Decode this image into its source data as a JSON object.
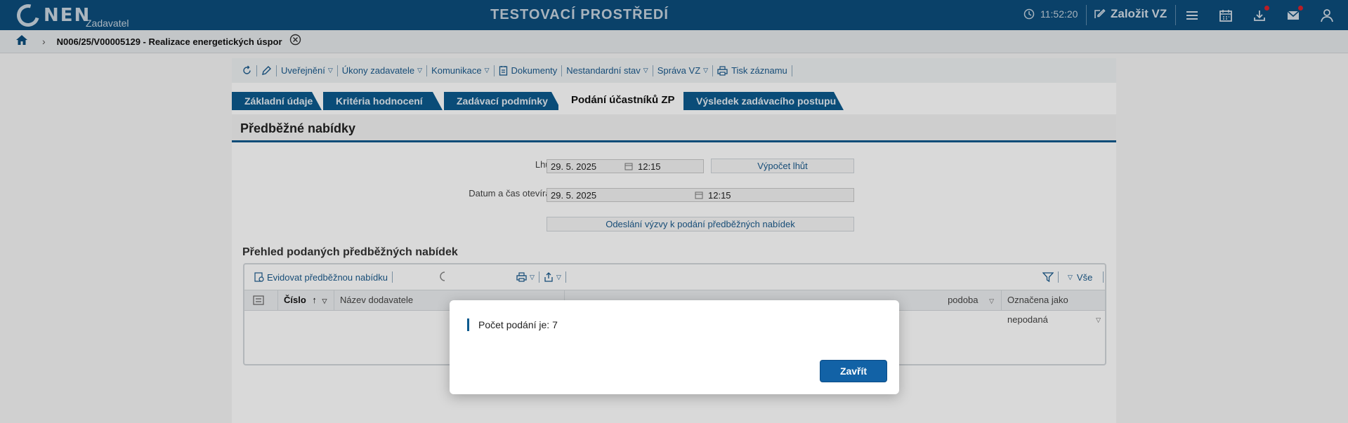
{
  "header": {
    "logo_text": "NEN",
    "logo_sub": "Zadavatel",
    "env_title": "TESTOVACÍ PROSTŘEDÍ",
    "time": "11:52:20",
    "create_vz_label": "Založit VZ"
  },
  "breadcrumb": {
    "title": "N006/25/V00005129 - Realizace energetických úspor"
  },
  "toolbar": {
    "items": [
      "Uveřejnění",
      "Úkony zadavatele",
      "Komunikace",
      "Dokumenty",
      "Nestandardní stav",
      "Správa VZ",
      "Tisk záznamu"
    ]
  },
  "tabs": [
    "Základní údaje",
    "Kritéria hodnocení",
    "Zadávací podmínky",
    "Podání účastníků ZP",
    "Výsledek zadávacího postupu"
  ],
  "section": {
    "title": "Předběžné nabídky",
    "deadline_label": "Lhůta:",
    "deadline_date": "29. 5. 2025",
    "deadline_time": "12:15",
    "calc_button": "Výpočet lhůt",
    "opening_label": "Datum a čas otevírání:",
    "opening_date": "29. 5. 2025",
    "opening_time": "12:15",
    "send_button": "Odeslání výzvy k podání předběžných nabídek"
  },
  "grid": {
    "title": "Přehled podaných předběžných nabídek",
    "add_button": "Evidovat předběžnou nabídku",
    "filter_all": "Vše",
    "columns": [
      "Číslo",
      "Název dodavatele",
      "podoba",
      "Označena jako nepodaná"
    ]
  },
  "dialog": {
    "message": "Počet podání je: 7",
    "close_button": "Zavřít"
  },
  "colors": {
    "header_bg": "#0c4d7c",
    "accent": "#1262a6"
  }
}
